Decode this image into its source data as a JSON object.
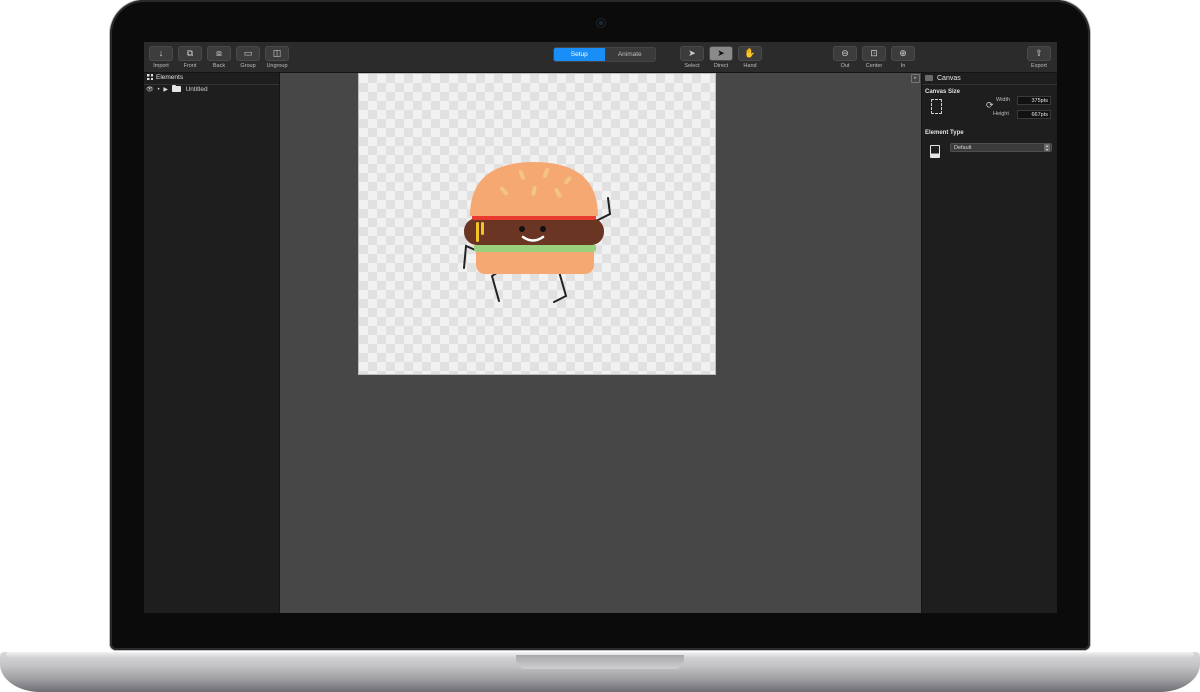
{
  "toolbar": {
    "left_buttons": [
      {
        "label": "Import",
        "icon": "arrow-down-icon"
      },
      {
        "label": "Front",
        "icon": "bring-front-icon"
      },
      {
        "label": "Back",
        "icon": "send-back-icon"
      },
      {
        "label": "Group",
        "icon": "folder-icon"
      },
      {
        "label": "Ungroup",
        "icon": "ungroup-icon"
      }
    ],
    "mode_tabs": {
      "setup": "Setup",
      "animate": "Animate",
      "selected": "Setup"
    },
    "tools": [
      {
        "label": "Select",
        "icon": "arrow-cursor-icon"
      },
      {
        "label": "Direct",
        "icon": "direct-select-icon"
      },
      {
        "label": "Hand",
        "icon": "hand-icon"
      }
    ],
    "zoom": [
      {
        "label": "Out",
        "icon": "zoom-out-icon"
      },
      {
        "label": "Center",
        "icon": "center-icon"
      },
      {
        "label": "In",
        "icon": "zoom-in-icon"
      }
    ],
    "export": {
      "label": "Export",
      "icon": "share-icon"
    }
  },
  "elements_panel": {
    "title": "Elements",
    "items": [
      {
        "label": "Untitled"
      }
    ]
  },
  "inspector": {
    "title": "Canvas",
    "canvas_size": {
      "heading": "Canvas Size",
      "width_label": "Width",
      "width_value": "375pts",
      "height_label": "Height",
      "height_value": "667pts"
    },
    "element_type": {
      "heading": "Element Type",
      "value": "Default"
    }
  },
  "colors": {
    "accent": "#1a8ef7",
    "bun": "#f6a873",
    "patty": "#6b3523",
    "ketchup": "#e83a2e",
    "lettuce": "#9ad07d",
    "mustard": "#f2c326"
  }
}
